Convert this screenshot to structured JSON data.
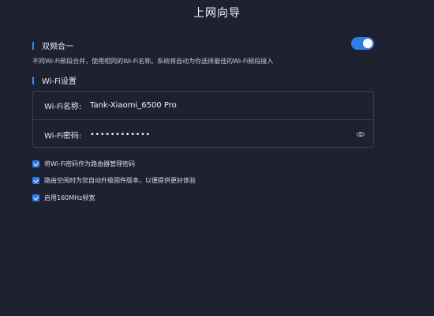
{
  "header": {
    "title": "上网向导"
  },
  "dual_band": {
    "section_label": "双频合一",
    "enabled": true,
    "hint": "不同Wi-Fi频段合并，使用相同的Wi-Fi名称。系统将自动为你选择最佳的Wi-Fi频段接入"
  },
  "wifi": {
    "section_label": "Wi-Fi设置",
    "name_label": "Wi-Fi名称:",
    "name_value": "Tank-Xiaomi_6500 Pro",
    "password_label": "Wi-Fi密码:",
    "password_value": "••••••••••••",
    "password_icon": "eye-icon"
  },
  "options": [
    {
      "label": "将Wi-Fi密码作为路由器管理密码",
      "checked": true
    },
    {
      "label": "路由空闲时为您自动升级固件版本，以便提供更好体验",
      "checked": true
    },
    {
      "label": "启用160MHz频宽",
      "checked": true
    }
  ],
  "colors": {
    "accent": "#2f7ee8",
    "background": "#1e2130",
    "border": "#3a3e4d"
  }
}
